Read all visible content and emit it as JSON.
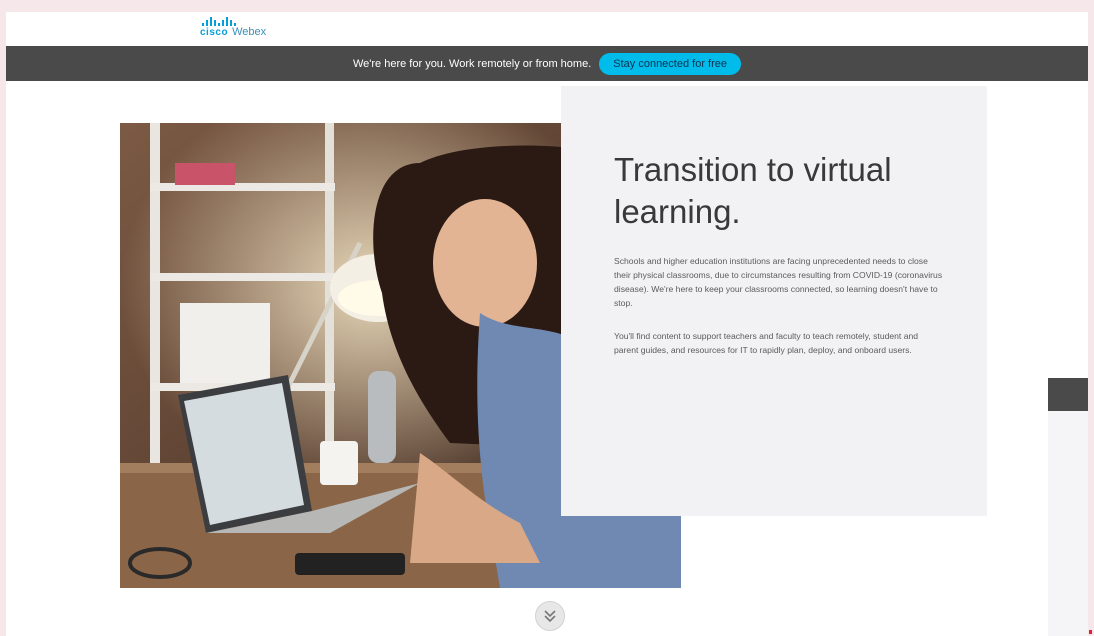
{
  "header": {
    "logo_cisco": "cisco",
    "logo_webex": "Webex"
  },
  "banner": {
    "text": "We're here for you. Work remotely or from home.",
    "button_label": "Stay connected for free"
  },
  "hero": {
    "title": "Transition to virtual learning.",
    "paragraphs": [
      "Schools and higher education institutions are facing unprecedented needs to close their physical classrooms, due to circumstances resulting from COVID-19 (coronavirus disease). We're here to keep your classrooms connected, so learning doesn't have to stop.",
      "You'll find content to support teachers and faculty to teach remotely, student and parent guides, and resources for IT to rapidly plan, deploy, and onboard users."
    ]
  },
  "colors": {
    "brand": "#049fd9",
    "banner_bg": "#4a4a4a",
    "button_bg": "#00bceb",
    "card_bg": "#f2f2f4"
  },
  "icons": {
    "scroll": "double-chevron-down-icon"
  }
}
